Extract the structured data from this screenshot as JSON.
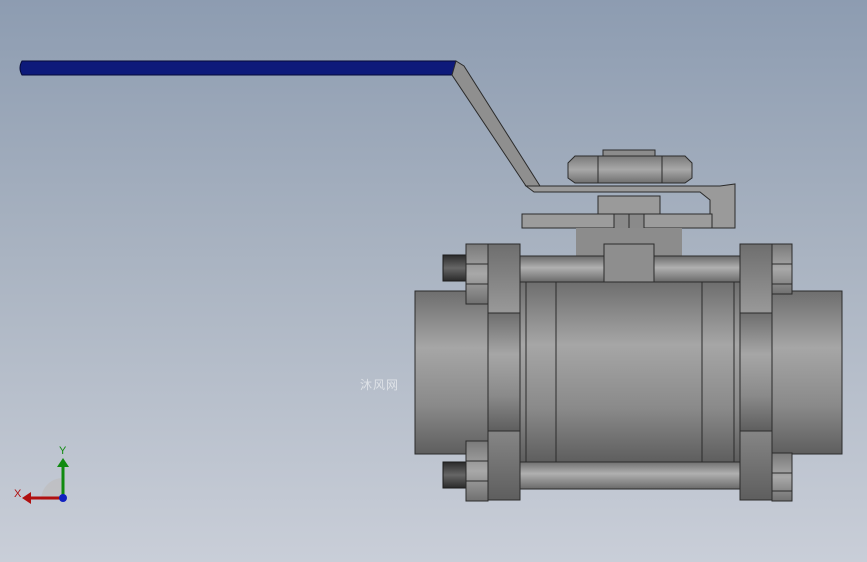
{
  "viewport": {
    "background_top": "#8d9cb1",
    "background_bottom": "#c9ced8",
    "watermark": "沐风网"
  },
  "model": {
    "handle_color": "#0e1a7a",
    "body_color": "#8c8c8c"
  },
  "triad": {
    "x_label": "X",
    "y_label": "Y",
    "x_color": "#b01010",
    "y_color": "#108a10",
    "origin_color": "#1020c0"
  }
}
